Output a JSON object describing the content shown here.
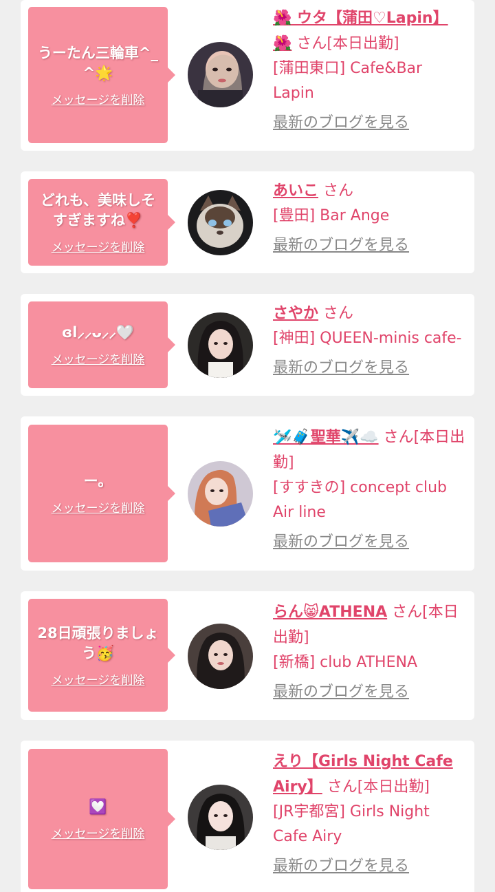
{
  "colors": {
    "background": "#efefef",
    "card": "#ffffff",
    "bubble": "#f7909f",
    "accent_text": "#e0446a",
    "muted_link": "#888888"
  },
  "entries": [
    {
      "message": "うーたん三輪車^_^🌟",
      "delete_label": "メッセージを削除",
      "name": "🌺 ウタ【蒲田♡Lapin】🌺",
      "suffix": "さん[本日出勤]",
      "shop": "[蒲田東口] Cafe&Bar\nLapin",
      "blog_label": "最新のブログを見る",
      "avatar_icon": "avatar-photo-woman"
    },
    {
      "message": "どれも、美味しそすぎますね❣️",
      "delete_label": "メッセージを削除",
      "name": "あいこ",
      "suffix": "さん",
      "shop": "[豊田] Bar Ange",
      "blog_label": "最新のブログを見る",
      "avatar_icon": "avatar-photo-cat"
    },
    {
      "message": "ɞl⸝⸝ᴗ⸝⸝🤍",
      "delete_label": "メッセージを削除",
      "name": "さやか",
      "suffix": "さん",
      "shop": "[神田] QUEEN-minis cafe-",
      "blog_label": "最新のブログを見る",
      "avatar_icon": "avatar-photo-woman"
    },
    {
      "message": "ー。",
      "delete_label": "メッセージを削除",
      "name": "🛩️🧳聖華✈️☁️",
      "suffix": "さん[本日出勤]",
      "shop": "[すすきの] concept club\nAir line",
      "blog_label": "最新のブログを見る",
      "avatar_icon": "avatar-photo-woman"
    },
    {
      "message": "28日頑張りましょう🥳",
      "delete_label": "メッセージを削除",
      "name": "らん😸ATHENA",
      "suffix": "さん[本日出勤]",
      "shop": "[新橋] club ATHENA",
      "blog_label": "最新のブログを見る",
      "avatar_icon": "avatar-photo-woman"
    },
    {
      "message": "💟",
      "delete_label": "メッセージを削除",
      "name": "えり【Girls Night Cafe Airy】",
      "suffix": "さん[本日出勤]",
      "shop": "[JR宇都宮] Girls Night\nCafe Airy",
      "blog_label": "最新のブログを見る",
      "avatar_icon": "avatar-photo-woman"
    }
  ]
}
